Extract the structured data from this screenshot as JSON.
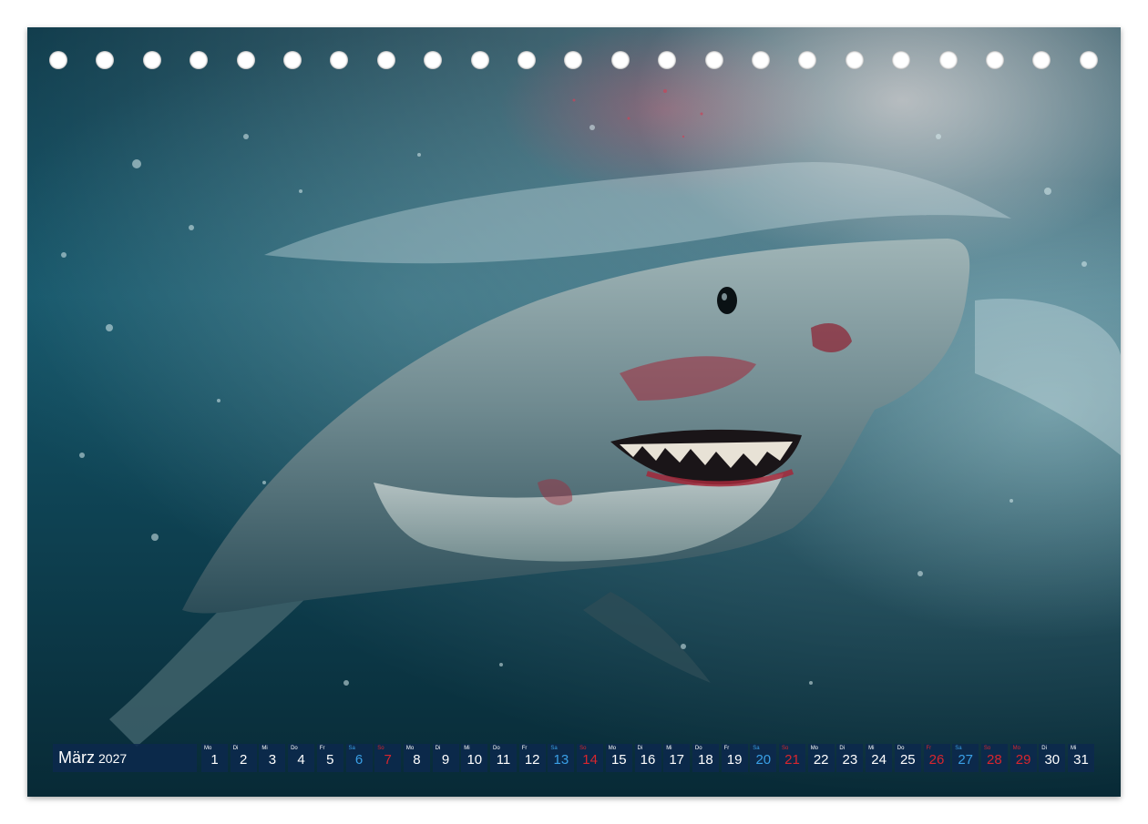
{
  "calendar": {
    "month": "März",
    "year": "2027",
    "days": [
      {
        "weekday": "Mo",
        "day": "1",
        "kind": "weekday"
      },
      {
        "weekday": "Di",
        "day": "2",
        "kind": "weekday"
      },
      {
        "weekday": "Mi",
        "day": "3",
        "kind": "weekday"
      },
      {
        "weekday": "Do",
        "day": "4",
        "kind": "weekday"
      },
      {
        "weekday": "Fr",
        "day": "5",
        "kind": "weekday"
      },
      {
        "weekday": "Sa",
        "day": "6",
        "kind": "sat"
      },
      {
        "weekday": "So",
        "day": "7",
        "kind": "sun"
      },
      {
        "weekday": "Mo",
        "day": "8",
        "kind": "weekday"
      },
      {
        "weekday": "Di",
        "day": "9",
        "kind": "weekday"
      },
      {
        "weekday": "Mi",
        "day": "10",
        "kind": "weekday"
      },
      {
        "weekday": "Do",
        "day": "11",
        "kind": "weekday"
      },
      {
        "weekday": "Fr",
        "day": "12",
        "kind": "weekday"
      },
      {
        "weekday": "Sa",
        "day": "13",
        "kind": "sat"
      },
      {
        "weekday": "So",
        "day": "14",
        "kind": "sun"
      },
      {
        "weekday": "Mo",
        "day": "15",
        "kind": "weekday"
      },
      {
        "weekday": "Di",
        "day": "16",
        "kind": "weekday"
      },
      {
        "weekday": "Mi",
        "day": "17",
        "kind": "weekday"
      },
      {
        "weekday": "Do",
        "day": "18",
        "kind": "weekday"
      },
      {
        "weekday": "Fr",
        "day": "19",
        "kind": "weekday"
      },
      {
        "weekday": "Sa",
        "day": "20",
        "kind": "sat"
      },
      {
        "weekday": "So",
        "day": "21",
        "kind": "sun"
      },
      {
        "weekday": "Mo",
        "day": "22",
        "kind": "weekday"
      },
      {
        "weekday": "Di",
        "day": "23",
        "kind": "weekday"
      },
      {
        "weekday": "Mi",
        "day": "24",
        "kind": "weekday"
      },
      {
        "weekday": "Do",
        "day": "25",
        "kind": "weekday"
      },
      {
        "weekday": "Fr",
        "day": "26",
        "kind": "sun"
      },
      {
        "weekday": "Sa",
        "day": "27",
        "kind": "sat"
      },
      {
        "weekday": "So",
        "day": "28",
        "kind": "sun"
      },
      {
        "weekday": "Mo",
        "day": "29",
        "kind": "sun"
      },
      {
        "weekday": "Di",
        "day": "30",
        "kind": "weekday"
      },
      {
        "weekday": "Mi",
        "day": "31",
        "kind": "weekday"
      }
    ]
  },
  "binding": {
    "hole_count": 23
  },
  "colors": {
    "strip_background": "#0c284e",
    "weekday_text": "#ffffff",
    "saturday_text": "#3aa0e6",
    "sunday_holiday_text": "#d8262e"
  },
  "image": {
    "subject_icon": "shark-photo"
  }
}
